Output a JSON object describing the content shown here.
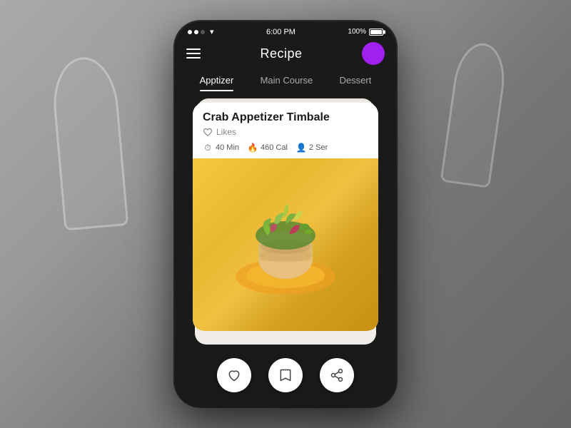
{
  "background": {
    "color": "#888888"
  },
  "status_bar": {
    "dots": [
      "active",
      "active",
      "dim"
    ],
    "time": "6:00 PM",
    "battery_pct": "100%",
    "signal": "wifi"
  },
  "header": {
    "title": "Recipe",
    "menu_icon_label": "menu",
    "avatar_color": "#a020f0"
  },
  "tabs": [
    {
      "label": "Apptizer",
      "active": true
    },
    {
      "label": "Main Course",
      "active": false
    },
    {
      "label": "Dessert",
      "active": false
    }
  ],
  "card": {
    "title": "Crab Appetizer Timbale",
    "likes_label": "Likes",
    "time": "40 Min",
    "calories": "460 Cal",
    "servings": "2 Ser"
  },
  "actions": [
    {
      "name": "like-button",
      "icon": "heart"
    },
    {
      "name": "bookmark-button",
      "icon": "bookmark"
    },
    {
      "name": "share-button",
      "icon": "share"
    }
  ]
}
